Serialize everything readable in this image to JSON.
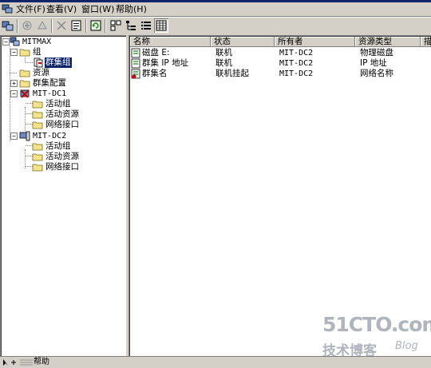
{
  "menubar": {
    "items": [
      {
        "label": "文件(F)"
      },
      {
        "label": "查看(V)"
      },
      {
        "label": "窗口(W)"
      },
      {
        "label": "帮助(H)"
      }
    ]
  },
  "tree": {
    "root": "MITMAX",
    "groups": "组",
    "cluster_group": "群集组",
    "resources": "资源",
    "cluster_config": "群集配置",
    "node1": {
      "name": "MIT-DC1",
      "children": [
        "活动组",
        "活动资源",
        "网络接口"
      ]
    },
    "node2": {
      "name": "MIT-DC2",
      "children": [
        "活动组",
        "活动资源",
        "网络接口"
      ]
    }
  },
  "list": {
    "columns": [
      "名称",
      "状态",
      "所有者",
      "资源类型",
      "描"
    ],
    "rows": [
      {
        "name": "磁盘 E:",
        "status": "联机",
        "owner": "MIT-DC2",
        "type": "物理磁盘",
        "icon": "disk-resource-icon"
      },
      {
        "name": "群集 IP 地址",
        "status": "联机",
        "owner": "MIT-DC2",
        "type": "IP 地址",
        "icon": "ip-resource-icon"
      },
      {
        "name": "群集名",
        "status": "联机挂起",
        "owner": "MIT-DC2",
        "type": "网络名称",
        "icon": "network-name-pending-icon"
      }
    ]
  },
  "statusbar": {
    "help": "帮助"
  },
  "watermark": {
    "logo": "51CTO.com",
    "sub": "技术博客",
    "blog": "Blog"
  },
  "colors": {
    "selection": "#0a246a",
    "chrome": "#d4d0c8",
    "offline_red": "#cc0000"
  }
}
